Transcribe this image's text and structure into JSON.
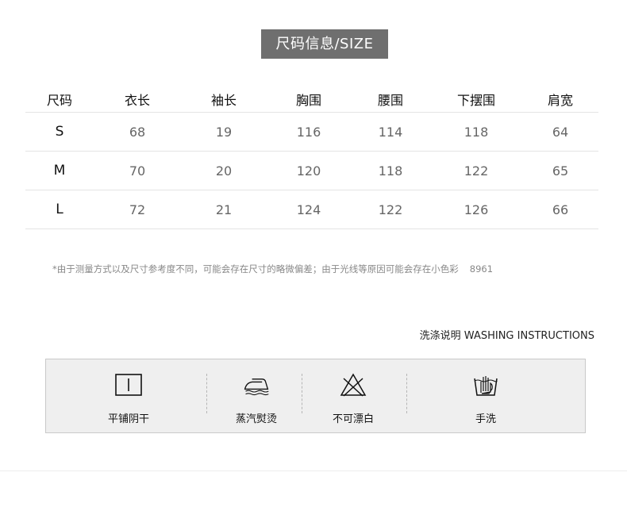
{
  "title": "尺码信息/SIZE",
  "table": {
    "headers": [
      "尺码",
      "衣长",
      "袖长",
      "胸围",
      "腰围",
      "下摆围",
      "肩宽"
    ],
    "rows": [
      [
        "S",
        "68",
        "19",
        "116",
        "114",
        "118",
        "64"
      ],
      [
        "M",
        "70",
        "20",
        "120",
        "118",
        "122",
        "65"
      ],
      [
        "L",
        "72",
        "21",
        "124",
        "122",
        "126",
        "66"
      ]
    ]
  },
  "note": {
    "text": "*由于测量方式以及尺寸参考度不同，可能会存在尺寸的略微偏差；由于光线等原因可能会存在小色彩",
    "number": "8961"
  },
  "washing": {
    "title": "洗涤说明 WASHING INSTRUCTIONS",
    "items": [
      {
        "icon": "flat-dry-shade-icon",
        "label": "平铺阴干"
      },
      {
        "icon": "steam-iron-icon",
        "label": "蒸汽熨烫"
      },
      {
        "icon": "no-bleach-icon",
        "label": "不可漂白"
      },
      {
        "icon": "hand-wash-icon",
        "label": "手洗"
      }
    ]
  }
}
